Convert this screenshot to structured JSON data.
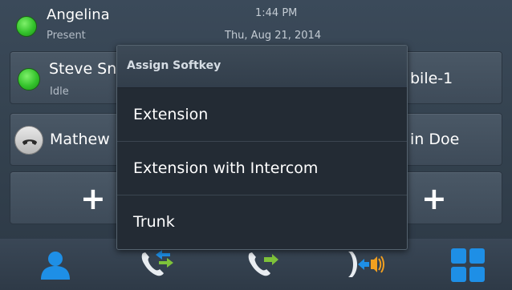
{
  "header": {
    "user_name": "Angelina",
    "user_status": "Present",
    "time": "1:44 PM",
    "date": "Thu, Aug 21, 2014"
  },
  "line_keys": [
    {
      "name": "Steve Sn",
      "status": "Idle",
      "presence": "available"
    },
    {
      "name": "Mathew",
      "status": "",
      "presence": "on-call"
    },
    {
      "name": "",
      "status": "",
      "presence": "empty"
    }
  ],
  "right_keys": [
    {
      "name": "bile-1"
    },
    {
      "name": "in Doe"
    },
    {
      "name": ""
    }
  ],
  "add_symbol": "+",
  "popup": {
    "title": "Assign Softkey",
    "items": [
      {
        "label": "Extension"
      },
      {
        "label": "Extension with Intercom"
      },
      {
        "label": "Trunk"
      }
    ]
  },
  "toolbar": {
    "icons": [
      "contacts-icon",
      "transfer-call-icon",
      "forward-call-icon",
      "intercom-icon",
      "apps-grid-icon"
    ]
  },
  "colors": {
    "presence_green": "#33c22b",
    "accent_blue": "#1e8fe6",
    "arrow_green": "#7ec23a",
    "arrow_orange": "#f2a020"
  }
}
